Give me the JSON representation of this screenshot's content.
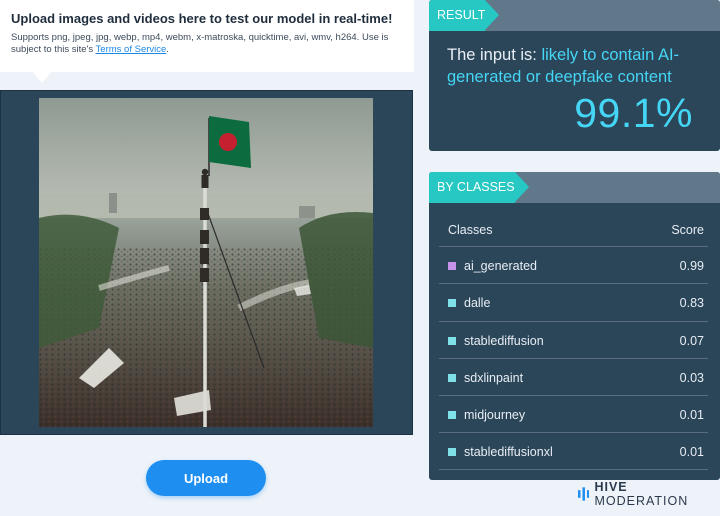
{
  "upload_info": {
    "title": "Upload images and videos here to test our model in real-time!",
    "supported_prefix": "Supports png, jpeg, jpg, webp, mp4, webm, x-matroska, quicktime, avi, wmv, h264. Use is subject to this site's ",
    "terms_link": "Terms of Service",
    "supported_suffix": "."
  },
  "upload_button": {
    "label": "Upload"
  },
  "result": {
    "header": "RESULT",
    "lead": "The input is: ",
    "verdict": "likely to contain AI-generated or deepfake content",
    "score": "99.1%"
  },
  "by_classes": {
    "header": "BY CLASSES",
    "col_classes": "Classes",
    "col_score": "Score",
    "rows": [
      {
        "name": "ai_generated",
        "score": "0.99",
        "dot_color": "#c792ea"
      },
      {
        "name": "dalle",
        "score": "0.83",
        "dot_color": "#7fe0e8"
      },
      {
        "name": "stablediffusion",
        "score": "0.07",
        "dot_color": "#7fe0e8"
      },
      {
        "name": "sdxlinpaint",
        "score": "0.03",
        "dot_color": "#7fe0e8"
      },
      {
        "name": "midjourney",
        "score": "0.01",
        "dot_color": "#7fe0e8"
      },
      {
        "name": "stablediffusionxl",
        "score": "0.01",
        "dot_color": "#7fe0e8"
      }
    ]
  },
  "brand": {
    "bold": "HIVE",
    "thin": "MODERATION",
    "icon": "hive-bars-icon"
  },
  "colors": {
    "panel": "#2b4559",
    "accent_teal": "#27c7c3",
    "highlight": "#45d6f5",
    "button": "#1e8ff0"
  }
}
